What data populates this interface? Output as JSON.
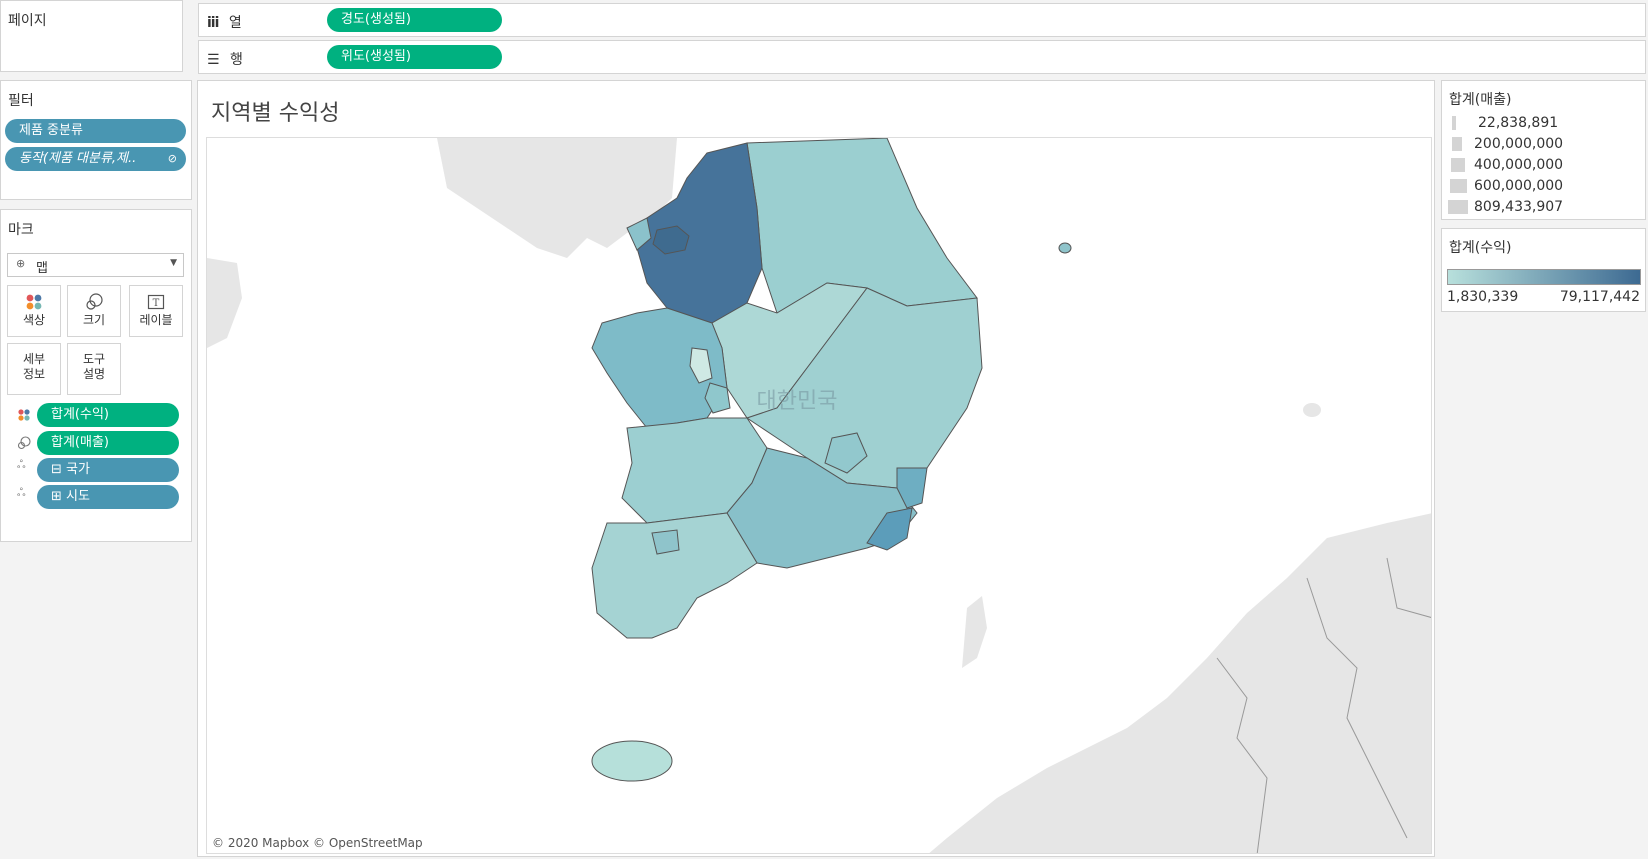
{
  "pages_panel": {
    "title": "페이지"
  },
  "shelves": {
    "columns": {
      "icon": "columns-icon",
      "label": "열",
      "pill": "경도(생성됨)"
    },
    "rows": {
      "icon": "rows-icon",
      "label": "행",
      "pill": "위도(생성됨)"
    }
  },
  "filters": {
    "title": "필터",
    "items": [
      "제품 중분류",
      "동작(제품 대분류,제.."
    ]
  },
  "marks": {
    "title": "마크",
    "type_select": "맵",
    "cards": {
      "color": "색상",
      "size": "크기",
      "label": "레이블",
      "detail_line1": "세부",
      "detail_line2": "정보",
      "tooltip_line1": "도구",
      "tooltip_line2": "설명"
    },
    "fields": [
      {
        "icon": "color-dots-icon",
        "label": "합계(수익)",
        "color": "#00b180"
      },
      {
        "icon": "size-icon",
        "label": "합계(매출)",
        "color": "#00b180"
      },
      {
        "icon": "detail-icon",
        "label": "⊟ 국가",
        "color": "#4996b2"
      },
      {
        "icon": "detail-icon",
        "label": "⊞ 시도",
        "color": "#4996b2"
      }
    ]
  },
  "view": {
    "title": "지역별 수익성",
    "country_label": "대한민국",
    "attribution": "© 2020 Mapbox © OpenStreetMap"
  },
  "legend_sales": {
    "title": "합계(매출)",
    "entries": [
      "22,838,891",
      "200,000,000",
      "400,000,000",
      "600,000,000",
      "809,433,907"
    ]
  },
  "legend_profit": {
    "title": "합계(수익)",
    "min": "1,830,339",
    "max": "79,117,442",
    "color_low": "#b8e0dc",
    "color_high": "#3d6a92"
  }
}
